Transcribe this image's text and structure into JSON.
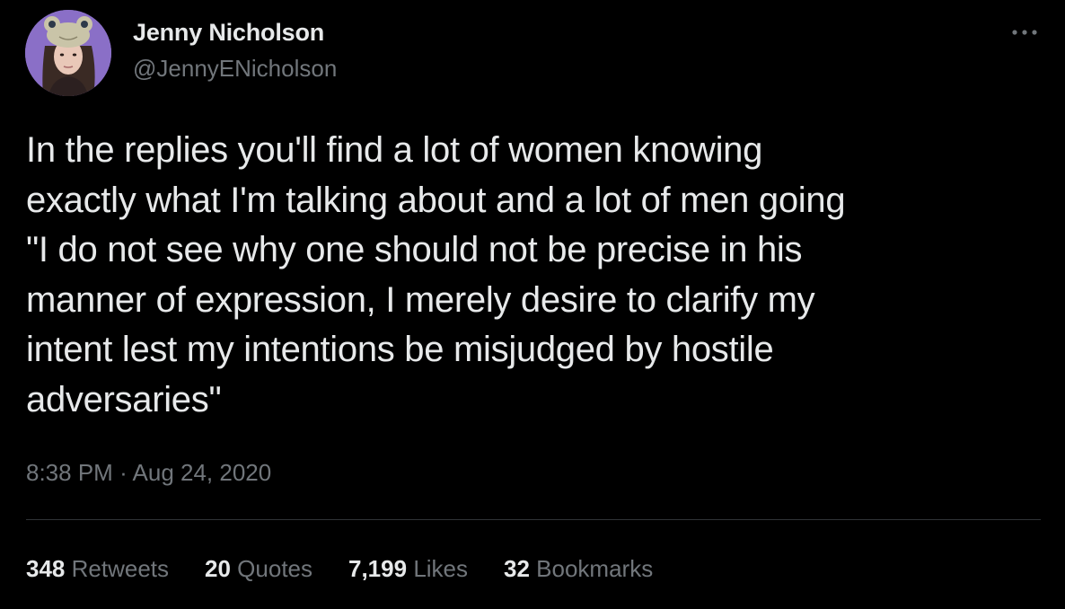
{
  "author": {
    "display_name": "Jenny Nicholson",
    "handle": "@JennyENicholson"
  },
  "tweet": {
    "text": "In the replies you'll find a lot of women knowing\nexactly what I'm talking about and a lot of men going\n\"I do not see why one should not be precise in his\nmanner of expression, I merely desire to clarify my\nintent lest my intentions be misjudged by hostile\nadversaries\"",
    "time": "8:38 PM",
    "separator": "·",
    "date": "Aug 24, 2020"
  },
  "stats": {
    "retweets": {
      "count": "348",
      "label": "Retweets"
    },
    "quotes": {
      "count": "20",
      "label": "Quotes"
    },
    "likes": {
      "count": "7,199",
      "label": "Likes"
    },
    "bookmarks": {
      "count": "32",
      "label": "Bookmarks"
    }
  },
  "icons": {
    "more": "more-horizontal-icon"
  },
  "colors": {
    "background": "#000000",
    "primary_text": "#e7e9ea",
    "secondary_text": "#71767b",
    "divider": "#2f3336",
    "avatar_bg": "#8a6fc7"
  }
}
